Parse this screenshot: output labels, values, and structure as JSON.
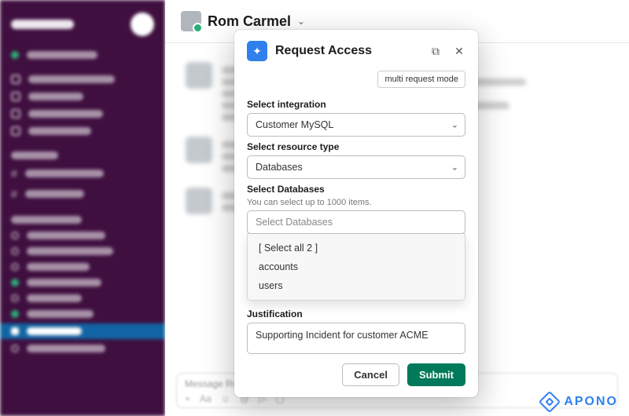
{
  "channel": {
    "name": "Rom Carmel"
  },
  "composer": {
    "placeholder": "Message Rom Carmel — 📅 In a meeting • Google Calendar"
  },
  "modal": {
    "title": "Request Access",
    "multi_mode_label": "multi request mode",
    "fields": {
      "integration": {
        "label": "Select integration",
        "value": "Customer MySQL"
      },
      "resource_type": {
        "label": "Select resource type",
        "value": "Databases"
      },
      "databases": {
        "label": "Select Databases",
        "hint": "You can select up to 1000 items.",
        "placeholder": "Select Databases",
        "options": {
          "select_all": "[ Select all 2 ]",
          "opt1": "accounts",
          "opt2": "users"
        }
      },
      "justification": {
        "label": "Justification",
        "value": "Supporting Incident for customer ACME"
      }
    },
    "buttons": {
      "cancel": "Cancel",
      "submit": "Submit"
    }
  },
  "watermark": {
    "text": "APONO"
  }
}
